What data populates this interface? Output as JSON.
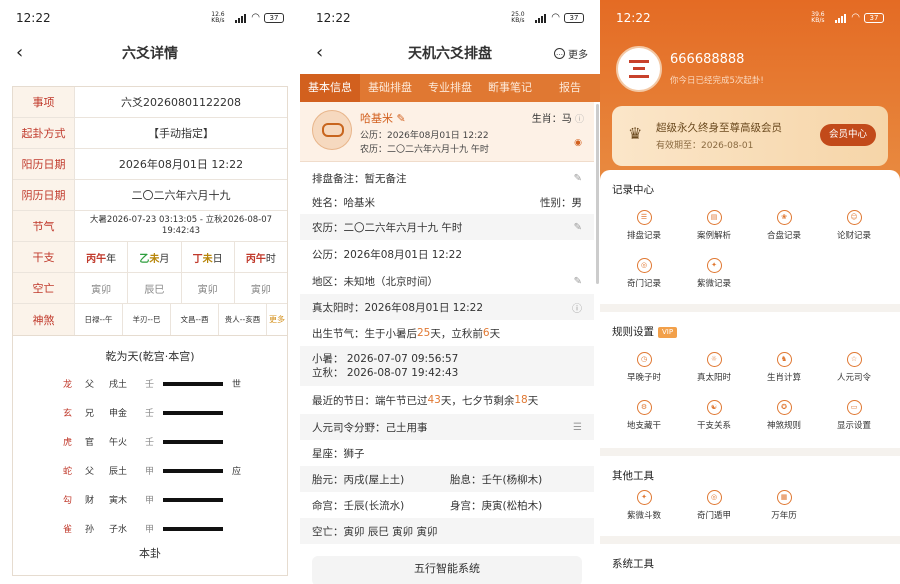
{
  "status": {
    "time": "12:22",
    "net1": "12.6 KB/s",
    "net2": "25.0 KB/s",
    "net3": "39.6 KB/s",
    "wifi": "5G",
    "battery": "37"
  },
  "p1": {
    "title": "六爻详情",
    "rows": [
      {
        "label": "事项",
        "value": "六爻20260801122208"
      },
      {
        "label": "起卦方式",
        "value": "【手动指定】"
      },
      {
        "label": "阳历日期",
        "value": "2026年08月01日 12:22"
      },
      {
        "label": "阴历日期",
        "value": "二〇二六年六月十九"
      },
      {
        "label": "节气",
        "value": "大暑2026-07-23 03:13:05 - 立秋2026-08-07 19:42:43"
      }
    ],
    "ganzhi_label": "干支",
    "ganzhi": [
      {
        "gan": "丙",
        "zhi": "午",
        "suf": "年"
      },
      {
        "gan": "乙",
        "zhi": "未",
        "suf": "月"
      },
      {
        "gan": "丁",
        "zhi": "未",
        "suf": "日"
      },
      {
        "gan": "丙",
        "zhi": "午",
        "suf": "时"
      }
    ],
    "kongwang_label": "空亡",
    "kongwang": [
      "寅卯",
      "辰巳",
      "寅卯",
      "寅卯"
    ],
    "shensha_label": "神煞",
    "shensha": [
      "日禄--午",
      "羊刃--巳",
      "文昌--酉",
      "贵人--亥酉"
    ],
    "shensha_more": "更多",
    "hex_title": "乾为天(乾宫·本宫)",
    "lines": [
      {
        "god": "龙",
        "rel": "父",
        "zhi": "戌土",
        "shi": "壬",
        "mark": "世"
      },
      {
        "god": "玄",
        "rel": "兄",
        "zhi": "申金",
        "shi": "壬",
        "mark": ""
      },
      {
        "god": "虎",
        "rel": "官",
        "zhi": "午火",
        "shi": "壬",
        "mark": ""
      },
      {
        "god": "蛇",
        "rel": "父",
        "zhi": "辰土",
        "shi": "甲",
        "mark": "应"
      },
      {
        "god": "勾",
        "rel": "财",
        "zhi": "寅木",
        "shi": "甲",
        "mark": ""
      },
      {
        "god": "雀",
        "rel": "孙",
        "zhi": "子水",
        "shi": "甲",
        "mark": ""
      }
    ],
    "bengua": "本卦"
  },
  "p2": {
    "title": "天机六爻排盘",
    "more": "更多",
    "tabs": [
      "基本信息",
      "基础排盘",
      "专业排盘",
      "断事笔记",
      "报告"
    ],
    "name": "哈基米",
    "zodiac": "生肖：马",
    "solar": "公历：2026年08月01日 12:22",
    "lunar": "农历：二〇二六年六月十九  午时",
    "remark": "排盘备注：暂无备注",
    "name_row": "姓名：哈基米",
    "gender": "性别：男",
    "lunar_row": "农历：二〇二六年六月十九  午时",
    "solar_row": "公历：2026年08月01日 12:22",
    "area": "地区：未知地（北京时间）",
    "true_solar": "真太阳时：2026年08月01日 12:22",
    "birth_jq_a": "出生节气：生于小暑后",
    "birth_jq_n1": "25",
    "birth_jq_b": "天，立秋前",
    "birth_jq_n2": "6",
    "birth_jq_c": "天",
    "xiaoshu": "小暑：  2026-07-07 09:56:57",
    "liqiu": "立秋：  2026-08-07 19:42:43",
    "festival_a": "最近的节日：端午节已过",
    "festival_n1": "43",
    "festival_b": "天，七夕节剩余",
    "festival_n2": "18",
    "festival_c": "天",
    "siling": "人元司令分野：己土用事",
    "star": "星座：狮子",
    "taiyuan": "胎元：丙戌(屋上土)",
    "taixi": "胎息：壬午(杨柳木)",
    "minggong": "命宫：壬辰(长流水)",
    "shengong": "身宫：庚寅(松柏木)",
    "kongwang": "空亡：寅卯 辰巳 寅卯 寅卯",
    "wuxing": "五行智能系统"
  },
  "p3": {
    "uid": "666688888",
    "sub": "你今日已经完成5次起卦!",
    "vip_title": "超级永久终身至尊高级会员",
    "vip_date": "有效期至：2026-08-01",
    "vip_btn": "会员中心",
    "sections": [
      {
        "title": "记录中心",
        "vip": "",
        "items": [
          "排盘记录",
          "案例解析",
          "合盘记录",
          "论财记录",
          "奇门记录",
          "紫微记录"
        ]
      },
      {
        "title": "规则设置",
        "vip": "VIP",
        "items": [
          "早晚子时",
          "真太阳时",
          "生肖计算",
          "人元司令",
          "地支藏干",
          "干支关系",
          "神煞规则",
          "显示设置"
        ]
      },
      {
        "title": "其他工具",
        "vip": "",
        "items": [
          "紫微斗数",
          "奇门遁甲",
          "万年历"
        ]
      },
      {
        "title": "系统工具",
        "vip": "",
        "items": []
      }
    ]
  }
}
